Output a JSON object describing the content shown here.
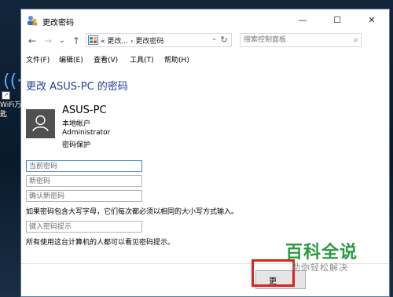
{
  "desktop": {
    "icon_name": "wifi-app-icon",
    "icon_label": "WiFi万\n匙"
  },
  "window": {
    "title": "更改密码",
    "controls": {
      "minimize": "—",
      "maximize": "☐",
      "close": "✕"
    }
  },
  "navigation": {
    "back": "←",
    "forward": "→",
    "recent": "⌄",
    "up": "↑",
    "address": {
      "prefix": "«",
      "crumb1": "更改...",
      "separator": "›",
      "crumb2": "更改密码",
      "dropdown": "⌄",
      "refresh": "↻"
    },
    "search_placeholder": "搜索控制面板"
  },
  "menu": [
    "文件(F)",
    "编辑(E)",
    "查看(V)",
    "工具(T)",
    "帮助(H)"
  ],
  "page": {
    "title": "更改 ASUS-PC 的密码"
  },
  "account": {
    "name": "ASUS-PC",
    "type": "本地帐户",
    "role": "Administrator",
    "protection": "密码保护"
  },
  "form": {
    "current_password_placeholder": "当前密码",
    "new_password_placeholder": "新密码",
    "confirm_password_placeholder": "确认新密码",
    "case_note": "如果密码包含大写字母，它们每次都必须以相同的大小写方式输入。",
    "hint_placeholder": "键入密码提示",
    "hint_note": "所有使用这台计算机的人都可以看见密码提示。"
  },
  "buttons": {
    "change": "更"
  },
  "watermark": {
    "title": "百科全说",
    "subtitle": "助你轻松解决"
  },
  "colors": {
    "title_blue": "#1e3f9a",
    "focus_blue": "#3c7fc4",
    "highlight_red": "#e0201d",
    "watermark_green": "#2a9a3e"
  }
}
